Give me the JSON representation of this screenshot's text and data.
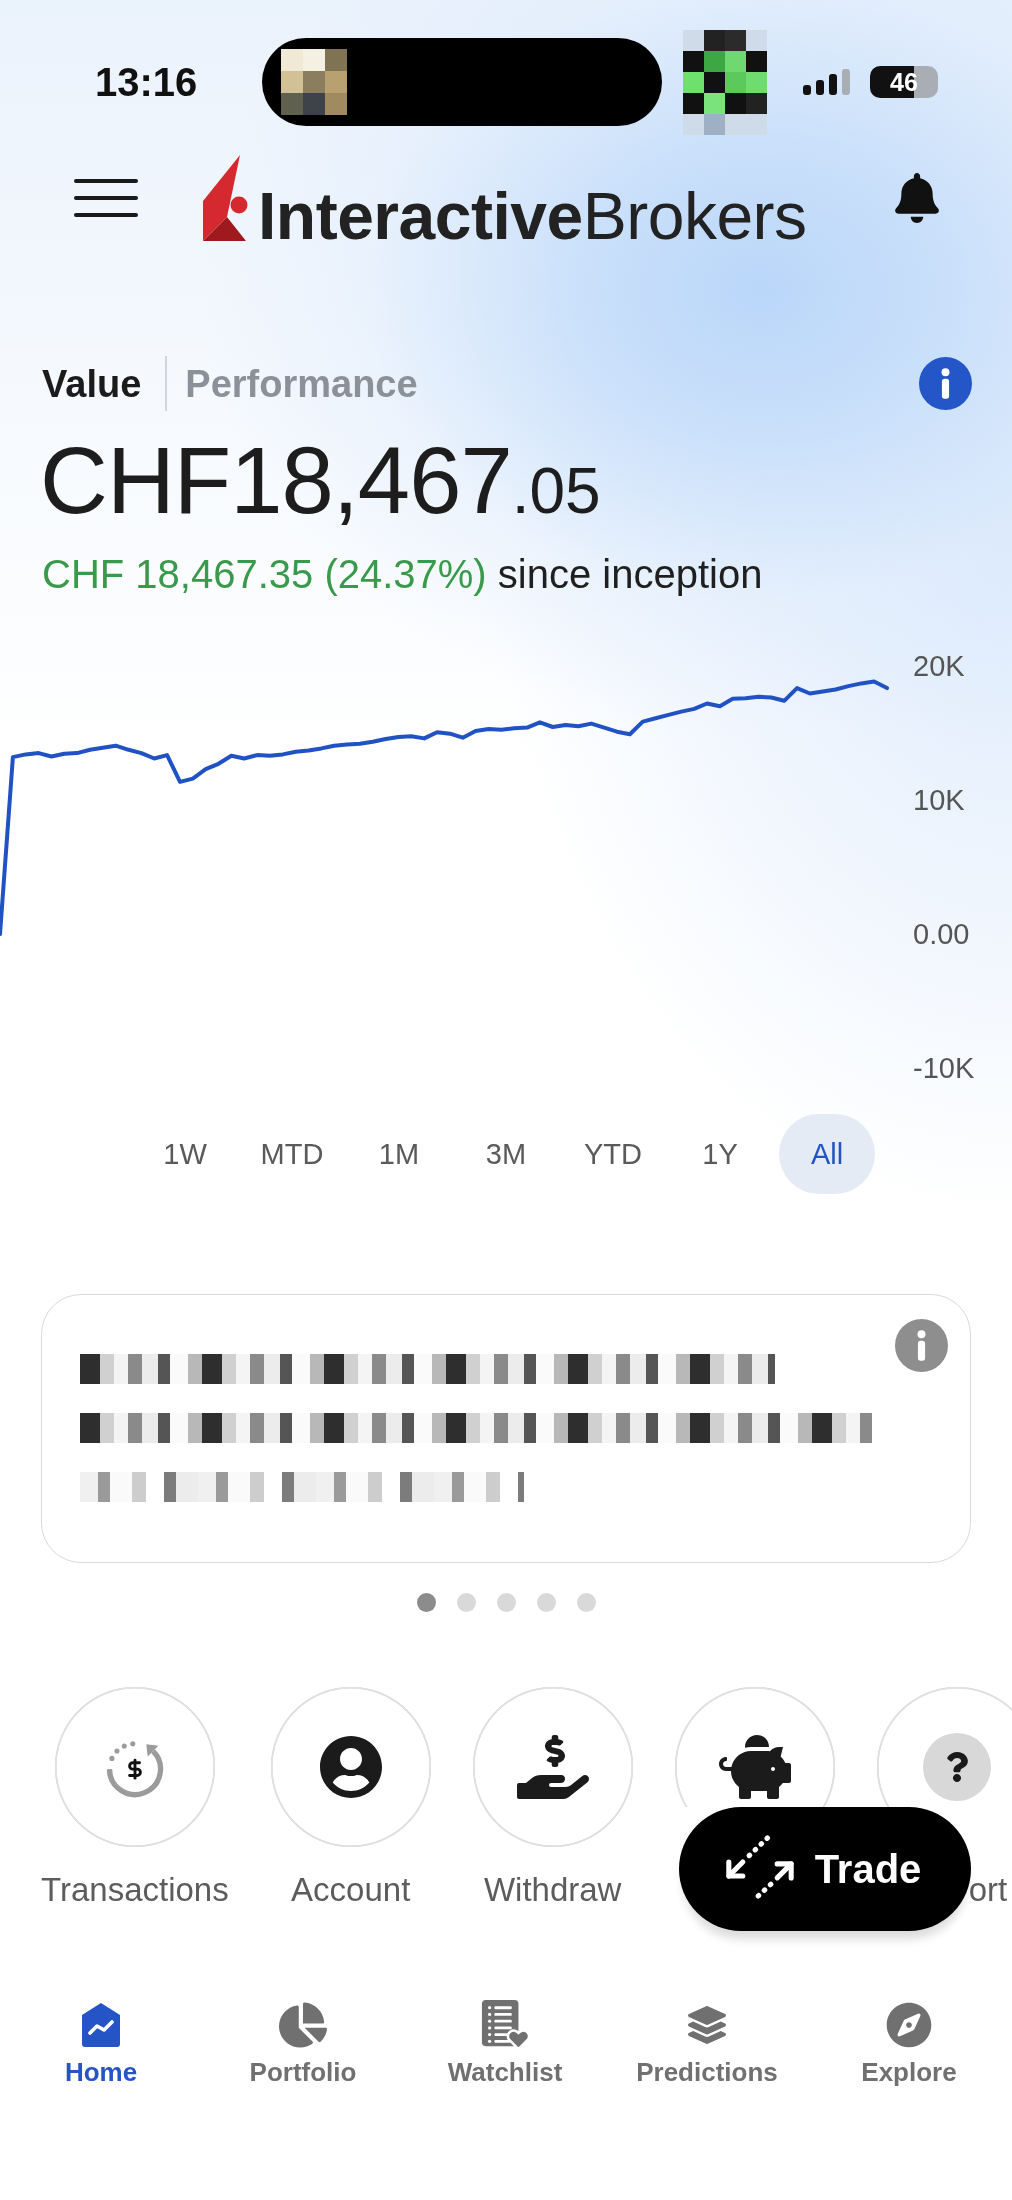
{
  "status_bar": {
    "time": "13:16",
    "battery": "46"
  },
  "header": {
    "logo": "**Interactive**Brokers"
  },
  "value_tabs": [
    {
      "label": "Value",
      "selected": true
    },
    {
      "label": "Performance",
      "selected": false
    }
  ],
  "balance": {
    "whole": "CHF18,467",
    "decimals": ".05"
  },
  "gain": {
    "change": "CHF 18,467.35 (24.37%)",
    "period": "since inception",
    "positive": true
  },
  "chart": {
    "chart_data": {
      "type": "line",
      "categories": [
        null,
        null,
        null,
        null,
        null,
        null,
        null,
        null,
        null,
        null,
        null,
        null,
        null,
        null,
        null,
        null,
        null,
        null,
        null,
        null,
        null,
        null,
        null,
        null,
        null,
        null,
        null,
        null,
        null,
        null,
        null,
        null,
        null,
        null,
        null,
        null,
        null,
        null,
        null,
        null,
        null,
        null,
        null,
        null,
        null,
        null,
        null,
        null,
        null,
        null,
        null,
        null,
        null,
        null,
        null,
        null,
        null,
        null,
        null,
        null,
        null,
        null,
        null,
        null,
        null,
        null,
        null,
        null,
        null,
        null
      ],
      "series": [
        {
          "color": "#2152c4",
          "values": [
            0,
            13200,
            13400,
            13500,
            13250,
            13450,
            13500,
            13750,
            13900,
            14050,
            13750,
            13500,
            13100,
            13350,
            11350,
            11600,
            12300,
            12700,
            13300,
            13100,
            13350,
            13300,
            13400,
            13600,
            13700,
            13850,
            14050,
            14150,
            14200,
            14350,
            14550,
            14700,
            14750,
            14600,
            15050,
            14950,
            14650,
            15150,
            15300,
            15250,
            15350,
            15400,
            15800,
            15450,
            15600,
            15500,
            15700,
            15400,
            15100,
            14900,
            15850,
            16100,
            16350,
            16600,
            16800,
            17200,
            17000,
            17550,
            17600,
            17700,
            17650,
            17400,
            18350,
            17950,
            18100,
            18250,
            18500,
            18700,
            18850,
            18350
          ]
        }
      ],
      "ylim": [
        -10000,
        20000
      ],
      "yticks": [
        {
          "value": 20000,
          "label": "20K"
        },
        {
          "value": 10000,
          "label": "10K"
        },
        {
          "value": 0,
          "label": "0.00"
        },
        {
          "value": -10000,
          "label": "-10K"
        }
      ]
    }
  },
  "ranges": [
    {
      "label": "1W",
      "selected": false
    },
    {
      "label": "MTD",
      "selected": false
    },
    {
      "label": "1M",
      "selected": false
    },
    {
      "label": "3M",
      "selected": false
    },
    {
      "label": "YTD",
      "selected": false
    },
    {
      "label": "1Y",
      "selected": false
    },
    {
      "label": "All",
      "selected": true
    }
  ],
  "carousel_dots": [
    {
      "selected": true
    },
    {
      "selected": false
    },
    {
      "selected": false
    },
    {
      "selected": false
    },
    {
      "selected": false
    }
  ],
  "shortcuts": [
    {
      "kind": "transactions",
      "label": "Transactions"
    },
    {
      "kind": "account",
      "label": "Account"
    },
    {
      "kind": "withdraw",
      "label": "Withdraw"
    },
    {
      "kind": "savings"
    },
    {
      "kind": "help",
      "label": "ort"
    }
  ],
  "trade_button": {
    "label": "Trade"
  },
  "bottom_nav": [
    {
      "kind": "home",
      "label": "Home",
      "selected": true
    },
    {
      "kind": "portfolio",
      "label": "Portfolio",
      "selected": false
    },
    {
      "kind": "watchlist",
      "label": "Watchlist",
      "selected": false
    },
    {
      "kind": "predictions",
      "label": "Predictions",
      "selected": false
    },
    {
      "kind": "explore",
      "label": "Explore",
      "selected": false
    }
  ]
}
